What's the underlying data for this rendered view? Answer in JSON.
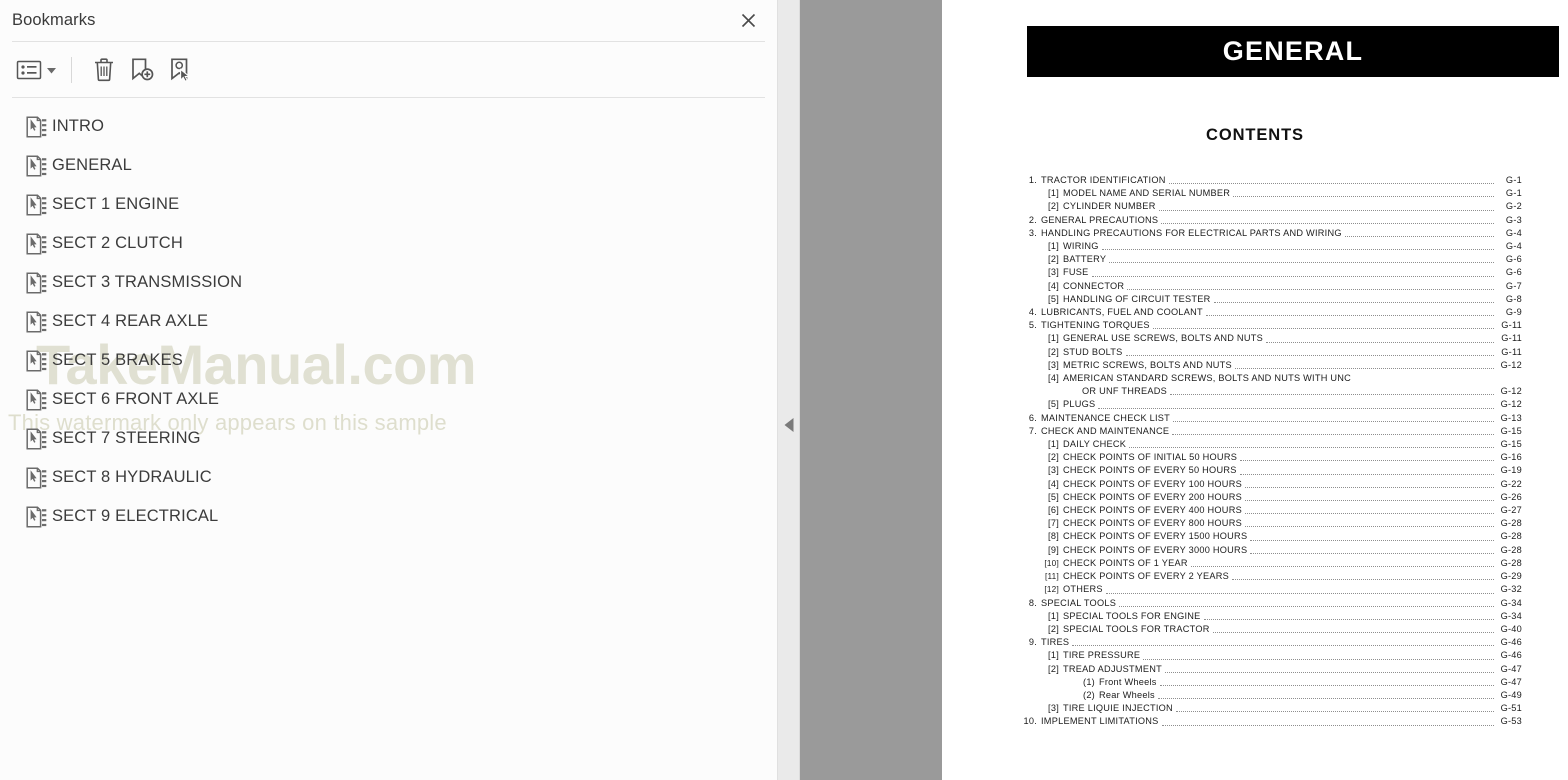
{
  "sidebar": {
    "title": "Bookmarks",
    "close_icon": "close-icon",
    "toolbar": {
      "list_options_icon": "list-options-icon",
      "caret_icon": "chevron-down-icon",
      "delete_icon": "trash-icon",
      "add_bookmark_icon": "add-bookmark-icon",
      "select_bookmark_icon": "select-bookmark-icon"
    },
    "items": [
      {
        "label": "INTRO"
      },
      {
        "label": "GENERAL"
      },
      {
        "label": "SECT 1 ENGINE"
      },
      {
        "label": "SECT 2 CLUTCH"
      },
      {
        "label": "SECT 3 TRANSMISSION"
      },
      {
        "label": "SECT 4 REAR AXLE"
      },
      {
        "label": "SECT 5 BRAKES"
      },
      {
        "label": "SECT 6 FRONT AXLE"
      },
      {
        "label": "SECT 7 STEERING"
      },
      {
        "label": "SECT 8 HYDRAULIC"
      },
      {
        "label": "SECT 9 ELECTRICAL"
      }
    ],
    "watermark": {
      "main": "TakeManual.com",
      "sub": "This watermark only appears on this sample"
    }
  },
  "splitter": {
    "collapse_icon": "triangle-left-icon"
  },
  "document": {
    "banner_title": "GENERAL",
    "contents_heading": "CONTENTS",
    "toc": [
      {
        "level": 0,
        "num": "1.",
        "text": "TRACTOR  IDENTIFICATION",
        "page": "G-1"
      },
      {
        "level": 1,
        "num": "[1]",
        "text": "MODEL NAME AND SERIAL NUMBER",
        "page": "G-1"
      },
      {
        "level": 1,
        "num": "[2]",
        "text": "CYLINDER  NUMBER",
        "page": "G-2"
      },
      {
        "level": 0,
        "num": "2.",
        "text": "GENERAL  PRECAUTIONS",
        "page": "G-3"
      },
      {
        "level": 0,
        "num": "3.",
        "text": "HANDLING  PRECAUTIONS  FOR  ELECTRICAL  PARTS  AND  WIRING",
        "page": "G-4"
      },
      {
        "level": 1,
        "num": "[1]",
        "text": "WIRING",
        "page": "G-4"
      },
      {
        "level": 1,
        "num": "[2]",
        "text": "BATTERY",
        "page": "G-6"
      },
      {
        "level": 1,
        "num": "[3]",
        "text": "FUSE",
        "page": "G-6"
      },
      {
        "level": 1,
        "num": "[4]",
        "text": "CONNECTOR",
        "page": "G-7"
      },
      {
        "level": 1,
        "num": "[5]",
        "text": "HANDLING  OF  CIRCUIT  TESTER",
        "page": "G-8"
      },
      {
        "level": 0,
        "num": "4.",
        "text": "LUBRICANTS,  FUEL  AND  COOLANT",
        "page": "G-9"
      },
      {
        "level": 0,
        "num": "5.",
        "text": "TIGHTENING  TORQUES",
        "page": "G-11"
      },
      {
        "level": 1,
        "num": "[1]",
        "text": "GENERAL  USE  SCREWS,  BOLTS  AND  NUTS",
        "page": "G-11"
      },
      {
        "level": 1,
        "num": "[2]",
        "text": "STUD  BOLTS",
        "page": "G-11"
      },
      {
        "level": 1,
        "num": "[3]",
        "text": "METRIC  SCREWS,  BOLTS  AND  NUTS",
        "page": "G-12"
      },
      {
        "level": 1,
        "num": "[4]",
        "text": "AMERICAN  STANDARD  SCREWS,  BOLTS  AND  NUTS  WITH  UNC",
        "page": "",
        "nodots": true
      },
      {
        "level": 1,
        "num": "",
        "text": "OR  UNF  THREADS",
        "page": "G-12",
        "continuation": true
      },
      {
        "level": 1,
        "num": "[5]",
        "text": "PLUGS",
        "page": "G-12"
      },
      {
        "level": 0,
        "num": "6.",
        "text": "MAINTENANCE  CHECK  LIST",
        "page": "G-13"
      },
      {
        "level": 0,
        "num": "7.",
        "text": "CHECK  AND  MAINTENANCE",
        "page": "G-15"
      },
      {
        "level": 1,
        "num": "[1]",
        "text": "DAILY  CHECK",
        "page": "G-15"
      },
      {
        "level": 1,
        "num": "[2]",
        "text": "CHECK  POINTS  OF  INITIAL  50  HOURS",
        "page": "G-16"
      },
      {
        "level": 1,
        "num": "[3]",
        "text": "CHECK  POINTS  OF  EVERY  50  HOURS",
        "page": "G-19"
      },
      {
        "level": 1,
        "num": "[4]",
        "text": "CHECK  POINTS  OF  EVERY  100  HOURS",
        "page": "G-22"
      },
      {
        "level": 1,
        "num": "[5]",
        "text": "CHECK  POINTS  OF  EVERY  200  HOURS",
        "page": "G-26"
      },
      {
        "level": 1,
        "num": "[6]",
        "text": "CHECK  POINTS  OF  EVERY  400  HOURS",
        "page": "G-27"
      },
      {
        "level": 1,
        "num": "[7]",
        "text": "CHECK  POINTS  OF  EVERY  800  HOURS",
        "page": "G-28"
      },
      {
        "level": 1,
        "num": "[8]",
        "text": "CHECK  POINTS  OF  EVERY  1500  HOURS",
        "page": "G-28"
      },
      {
        "level": 1,
        "num": "[9]",
        "text": "CHECK  POINTS  OF  EVERY  3000  HOURS",
        "page": "G-28"
      },
      {
        "level": 1,
        "num": "[10]",
        "text": "CHECK  POINTS  OF  1  YEAR",
        "page": "G-28",
        "tight": true
      },
      {
        "level": 1,
        "num": "[11]",
        "text": "CHECK  POINTS  OF  EVERY  2  YEARS",
        "page": "G-29",
        "tight": true
      },
      {
        "level": 1,
        "num": "[12]",
        "text": "OTHERS",
        "page": "G-32",
        "tight": true
      },
      {
        "level": 0,
        "num": "8.",
        "text": "SPECIAL  TOOLS",
        "page": "G-34"
      },
      {
        "level": 1,
        "num": "[1]",
        "text": "SPECIAL  TOOLS  FOR  ENGINE",
        "page": "G-34"
      },
      {
        "level": 1,
        "num": "[2]",
        "text": "SPECIAL  TOOLS  FOR  TRACTOR",
        "page": "G-40"
      },
      {
        "level": 0,
        "num": "9.",
        "text": "TIRES",
        "page": "G-46"
      },
      {
        "level": 1,
        "num": "[1]",
        "text": "TIRE  PRESSURE",
        "page": "G-46"
      },
      {
        "level": 1,
        "num": "[2]",
        "text": "TREAD  ADJUSTMENT",
        "page": "G-47"
      },
      {
        "level": 2,
        "num": "(1)",
        "text": "Front Wheels",
        "page": "G-47"
      },
      {
        "level": 2,
        "num": "(2)",
        "text": "Rear Wheels",
        "page": "G-49"
      },
      {
        "level": 1,
        "num": "[3]",
        "text": "TIRE  LIQUIE  INJECTION",
        "page": "G-51"
      },
      {
        "level": 0,
        "num": "10.",
        "text": "IMPLEMENT  LIMITATIONS",
        "page": "G-53"
      }
    ]
  }
}
